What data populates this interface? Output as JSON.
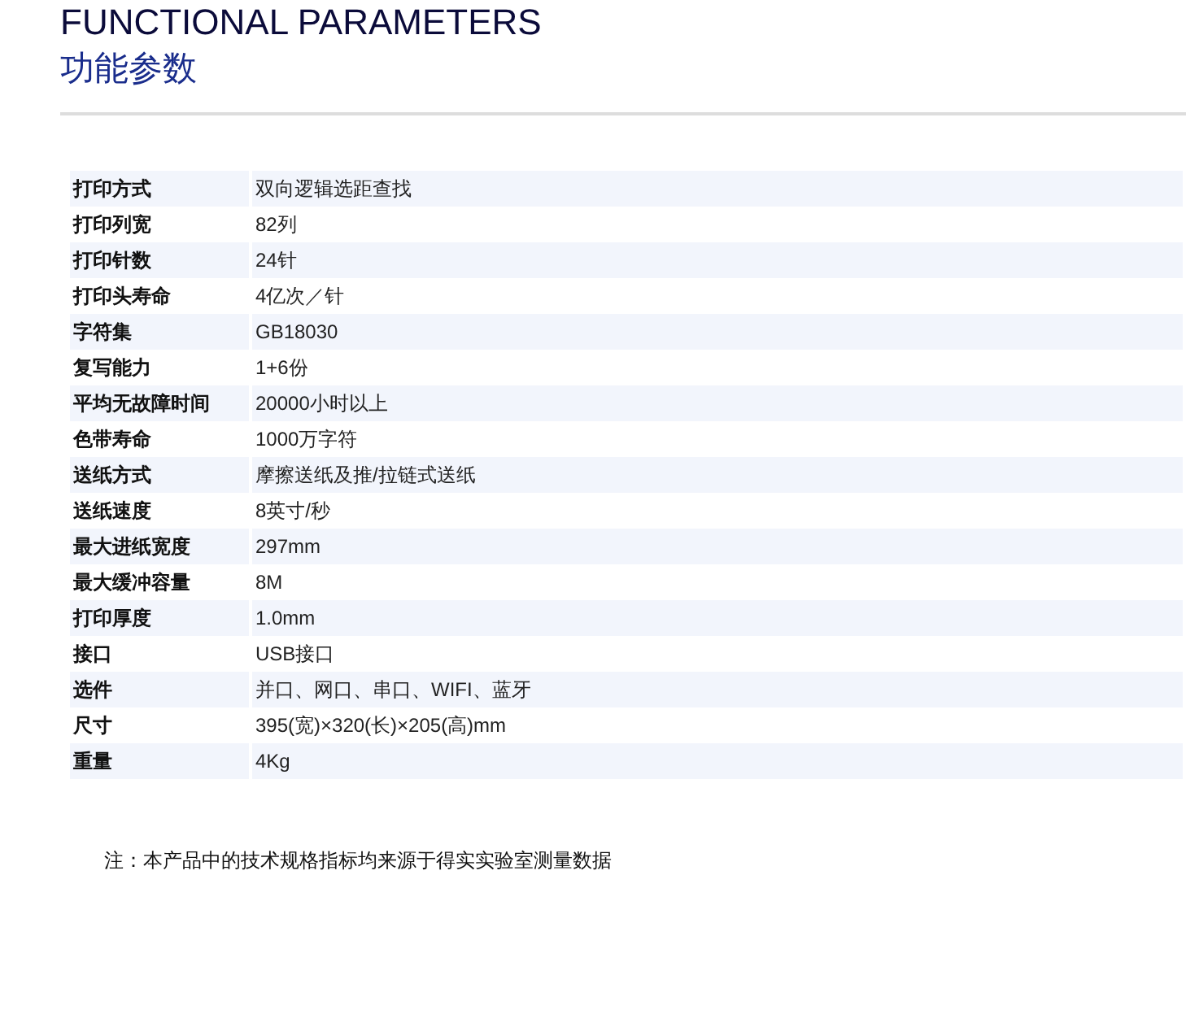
{
  "title": "FUNCTIONAL PARAMETERS",
  "subtitle": "功能参数",
  "specs": [
    {
      "label": "打印方式",
      "value": "双向逻辑选距查找"
    },
    {
      "label": "打印列宽",
      "value": "82列"
    },
    {
      "label": "打印针数",
      "value": "24针"
    },
    {
      "label": "打印头寿命",
      "value": "4亿次／针"
    },
    {
      "label": "字符集",
      "value": "GB18030"
    },
    {
      "label": "复写能力",
      "value": "1+6份"
    },
    {
      "label": "平均无故障时间",
      "value": "20000小时以上"
    },
    {
      "label": "色带寿命",
      "value": "1000万字符"
    },
    {
      "label": "送纸方式",
      "value": "摩擦送纸及推/拉链式送纸"
    },
    {
      "label": "送纸速度",
      "value": "8英寸/秒"
    },
    {
      "label": "最大进纸宽度",
      "value": "297mm"
    },
    {
      "label": "最大缓冲容量",
      "value": "8M"
    },
    {
      "label": "打印厚度",
      "value": "1.0mm"
    },
    {
      "label": "接口",
      "value": "USB接口"
    },
    {
      "label": "选件",
      "value": "并口、网口、串口、WIFI、蓝牙"
    },
    {
      "label": "尺寸",
      "value": "395(宽)×320(长)×205(高)mm"
    },
    {
      "label": "重量",
      "value": "4Kg"
    }
  ],
  "note": "注：本产品中的技术规格指标均来源于得实实验室测量数据"
}
